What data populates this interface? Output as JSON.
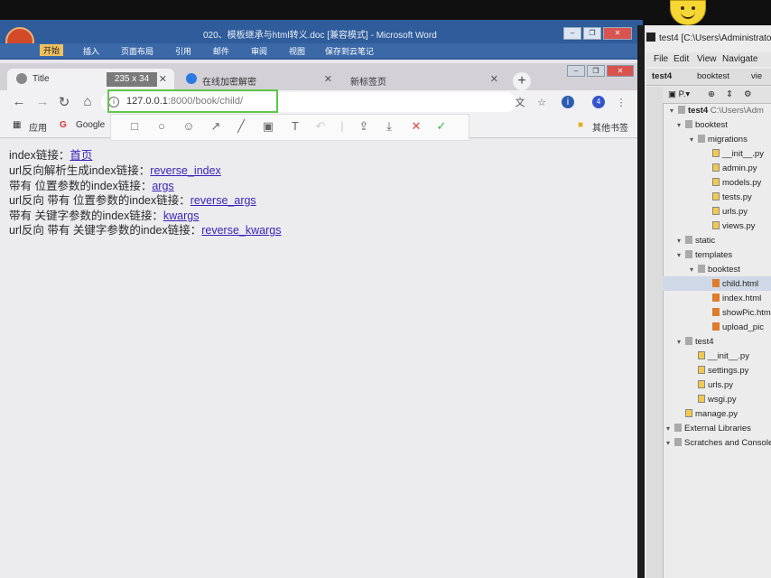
{
  "word": {
    "title": "020、模板继承与html转义.doc [兼容模式] - Microsoft Word",
    "ribbon": [
      "开始",
      "插入",
      "页面布局",
      "引用",
      "邮件",
      "审阅",
      "视图",
      "保存到云笔记"
    ]
  },
  "browser": {
    "tabs": [
      {
        "label": "Title"
      },
      {
        "label": "在线加密解密"
      },
      {
        "label": "新标签页"
      }
    ],
    "url_host": "127.0.0.1",
    "url_path": ":8000/book/child/",
    "snip_size": "235 x 34",
    "bookmarks": {
      "apps": "应用",
      "google": "Google",
      "other": "其他书签"
    }
  },
  "page": {
    "lines": [
      {
        "text": "index链接：",
        "link": "首页"
      },
      {
        "text": "url反向解析生成index链接：",
        "link": "reverse_index"
      },
      {
        "text": "带有 位置参数的index链接：",
        "link": "args"
      },
      {
        "text": "url反向 带有 位置参数的index链接：",
        "link": "reverse_args"
      },
      {
        "text": "带有 关键字参数的index链接：",
        "link": "kwargs"
      },
      {
        "text": "url反向 带有 关键字参数的index链接：",
        "link": "reverse_kwargs"
      }
    ]
  },
  "pycharm": {
    "title": "test4 [C:\\Users\\Administrato",
    "menu": [
      "File",
      "Edit",
      "View",
      "Navigate"
    ],
    "crumb": [
      "test4",
      "booktest",
      "vie"
    ],
    "project_root": "test4",
    "project_root_path": "C:\\Users\\Adm",
    "tree": [
      {
        "label": "booktest",
        "type": "folder",
        "indent": 1
      },
      {
        "label": "migrations",
        "type": "folder",
        "indent": 2
      },
      {
        "label": "__init__.py",
        "type": "py",
        "indent": 3
      },
      {
        "label": "admin.py",
        "type": "py",
        "indent": 3
      },
      {
        "label": "models.py",
        "type": "py",
        "indent": 3
      },
      {
        "label": "tests.py",
        "type": "py",
        "indent": 3
      },
      {
        "label": "urls.py",
        "type": "py",
        "indent": 3
      },
      {
        "label": "views.py",
        "type": "py",
        "indent": 3
      },
      {
        "label": "static",
        "type": "folder",
        "indent": 1
      },
      {
        "label": "templates",
        "type": "folder",
        "indent": 1
      },
      {
        "label": "booktest",
        "type": "folder",
        "indent": 2
      },
      {
        "label": "child.html",
        "type": "html",
        "indent": 3
      },
      {
        "label": "index.html",
        "type": "html",
        "indent": 3
      },
      {
        "label": "showPic.htm",
        "type": "html",
        "indent": 3
      },
      {
        "label": "upload_pic",
        "type": "html",
        "indent": 3
      },
      {
        "label": "test4",
        "type": "folder",
        "indent": 1
      },
      {
        "label": "__init__.py",
        "type": "py",
        "indent": 2
      },
      {
        "label": "settings.py",
        "type": "py",
        "indent": 2
      },
      {
        "label": "urls.py",
        "type": "py",
        "indent": 2
      },
      {
        "label": "wsgi.py",
        "type": "py",
        "indent": 2
      },
      {
        "label": "manage.py",
        "type": "py",
        "indent": 1
      },
      {
        "label": "External Libraries",
        "type": "folder",
        "indent": 0
      },
      {
        "label": "Scratches and Console",
        "type": "folder",
        "indent": 0
      }
    ]
  }
}
